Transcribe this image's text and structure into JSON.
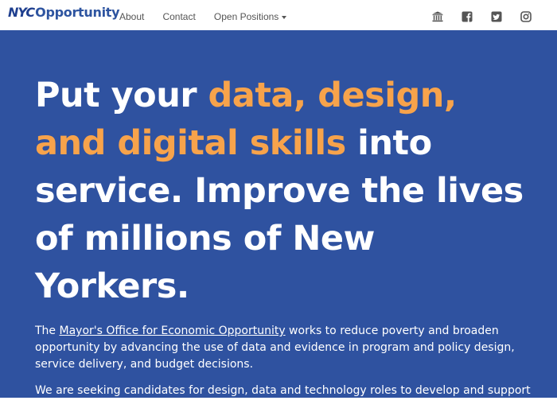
{
  "nav": {
    "brand_nyc": "NYC",
    "brand_opportunity": "Opportunity",
    "links": [
      "About",
      "Contact",
      "Open Positions"
    ],
    "social_icons": [
      "building-icon",
      "facebook-icon",
      "twitter-icon",
      "instagram-icon"
    ]
  },
  "hero": {
    "title_1": "Put your ",
    "title_highlight_1": "data, design, and digital skills",
    "title_2": " into service. Improve the lives of millions of New Yorkers.",
    "p1_prefix": "The ",
    "p1_link": "Mayor's Office for Economic Opportunity",
    "p1_suffix": " works to reduce poverty and broaden opportunity by advancing the use of data and evidence in program and policy design, service delivery, and budget decisions.",
    "p2": "We are seeking candidates for design, data and technology roles to develop and support digital products that reduce poverty and advance opportunity for City residents."
  },
  "colors": {
    "hero_bg": "#2f52a0",
    "highlight": "#f7a34b",
    "brand": "#2d54a0",
    "nav_text": "#555555"
  }
}
